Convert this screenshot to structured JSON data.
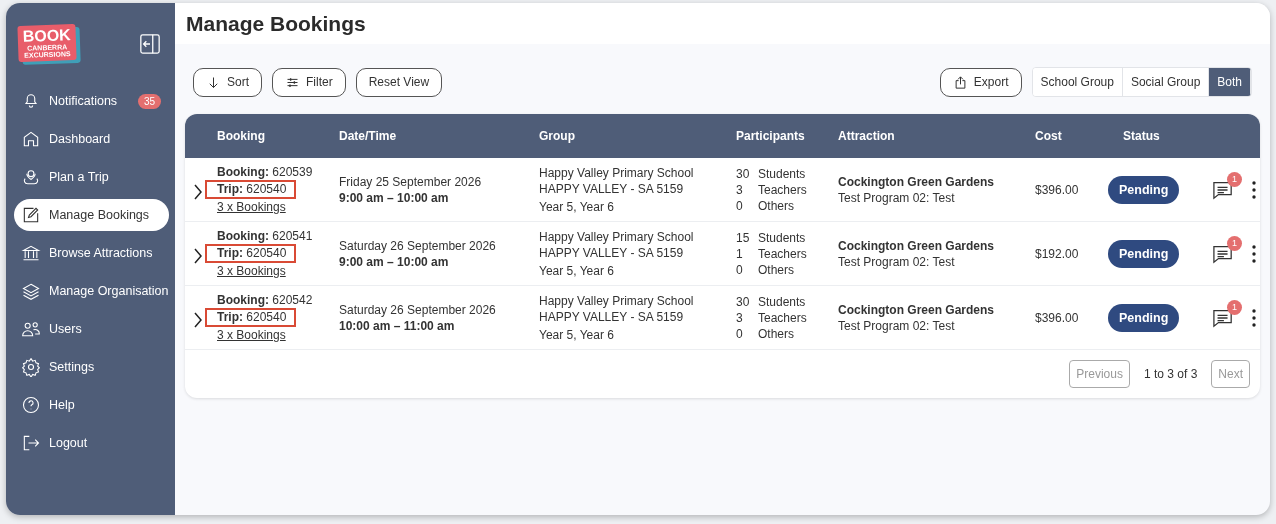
{
  "logo": {
    "lines": [
      "BOOK",
      "CANBERRA",
      "EXCURSIONS"
    ]
  },
  "sidebar": {
    "items": [
      {
        "label": "Notifications",
        "badge": "35",
        "selected": false
      },
      {
        "label": "Dashboard",
        "selected": false
      },
      {
        "label": "Plan a Trip",
        "selected": false
      },
      {
        "label": "Manage Bookings",
        "selected": true
      },
      {
        "label": "Browse Attractions",
        "selected": false
      },
      {
        "label": "Manage Organisation",
        "selected": false
      },
      {
        "label": "Users",
        "selected": false
      },
      {
        "label": "Settings",
        "selected": false
      },
      {
        "label": "Help",
        "selected": false
      },
      {
        "label": "Logout",
        "selected": false
      }
    ]
  },
  "page_title": "Manage Bookings",
  "toolbar": {
    "buttons": [
      {
        "label": "Sort"
      },
      {
        "label": "Filter"
      },
      {
        "label": "Reset View"
      }
    ],
    "export": "Export",
    "group_filter": [
      {
        "label": "School Group",
        "selected": false
      },
      {
        "label": "Social Group",
        "selected": false
      },
      {
        "label": "Both",
        "selected": true
      }
    ]
  },
  "table": {
    "columns": [
      "Booking",
      "Date/Time",
      "Group",
      "Participants",
      "Attraction",
      "Cost",
      "Status"
    ],
    "rows": [
      {
        "booking_label": "Booking:",
        "booking": "620539",
        "trip_label": "Trip:",
        "trip": "620540",
        "trip_highlighted": true,
        "bookings_link": "3 x Bookings",
        "date": "Friday 25 September 2026",
        "time": "9:00 am – 10:00 am",
        "school": "Happy Valley Primary School",
        "location": "HAPPY VALLEY - SA 5159",
        "years": "Year 5, Year 6",
        "participants": [
          {
            "count": "30",
            "label": "Students"
          },
          {
            "count": "3",
            "label": "Teachers"
          },
          {
            "count": "0",
            "label": "Others"
          }
        ],
        "attraction": "Cockington Green Gardens",
        "program": "Test Program 02: Test",
        "cost": "$396.00",
        "status": "Pending",
        "messages": "1"
      },
      {
        "booking_label": "Booking:",
        "booking": "620541",
        "trip_label": "Trip:",
        "trip": "620540",
        "trip_highlighted": true,
        "bookings_link": "3 x Bookings",
        "date": "Saturday 26 September 2026",
        "time": "9:00 am – 10:00 am",
        "school": "Happy Valley Primary School",
        "location": "HAPPY VALLEY - SA 5159",
        "years": "Year 5, Year 6",
        "participants": [
          {
            "count": "15",
            "label": "Students"
          },
          {
            "count": "1",
            "label": "Teachers"
          },
          {
            "count": "0",
            "label": "Others"
          }
        ],
        "attraction": "Cockington Green Gardens",
        "program": "Test Program 02: Test",
        "cost": "$192.00",
        "status": "Pending",
        "messages": "1"
      },
      {
        "booking_label": "Booking:",
        "booking": "620542",
        "trip_label": "Trip:",
        "trip": "620540",
        "trip_highlighted": true,
        "bookings_link": "3 x Bookings",
        "date": "Saturday 26 September 2026",
        "time": "10:00 am – 11:00 am",
        "school": "Happy Valley Primary School",
        "location": "HAPPY VALLEY - SA 5159",
        "years": "Year 5, Year 6",
        "participants": [
          {
            "count": "30",
            "label": "Students"
          },
          {
            "count": "3",
            "label": "Teachers"
          },
          {
            "count": "0",
            "label": "Others"
          }
        ],
        "attraction": "Cockington Green Gardens",
        "program": "Test Program 02: Test",
        "cost": "$396.00",
        "status": "Pending",
        "messages": "1"
      }
    ]
  },
  "pagination": {
    "previous": {
      "label": "Previous",
      "disabled": true
    },
    "range": "1 to 3 of 3",
    "next": {
      "label": "Next",
      "disabled": true
    }
  }
}
